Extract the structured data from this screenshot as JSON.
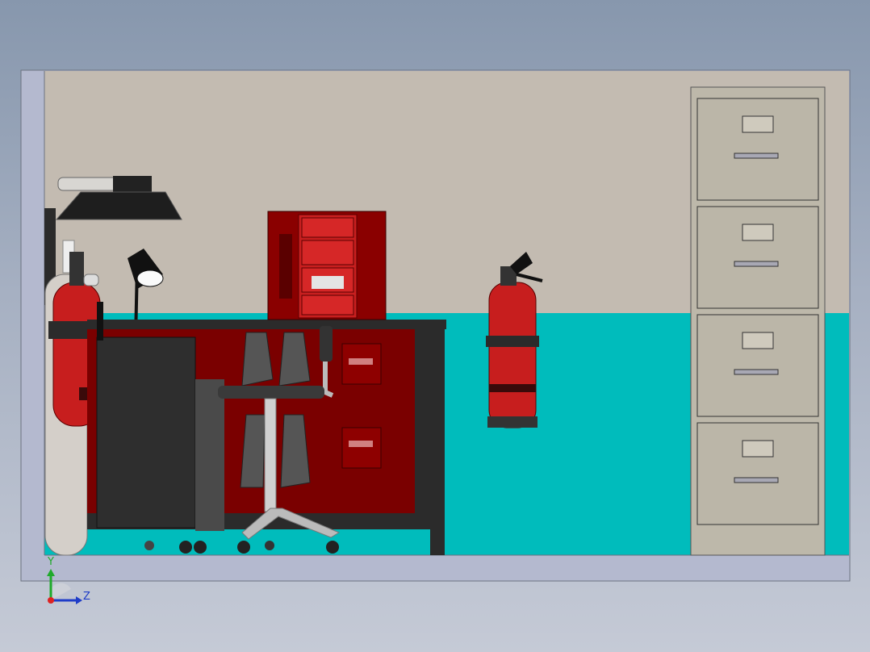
{
  "viewport": {
    "background_top": "#8797ad",
    "background_bottom": "#c5cad6"
  },
  "colors": {
    "room_frame": "#b4b9cf",
    "wall_upper": "#c3bbb1",
    "wall_lower": "#00bcbc",
    "cabinet_red": "#7a0000",
    "bright_red": "#cc1f1f",
    "dark_gray": "#2a2a2a",
    "file_cabinet": "#bdb8aa",
    "axis_x": "#1e3cc8",
    "axis_y": "#1faa2a"
  },
  "triad": {
    "y_label": "Y",
    "z_label": "Z",
    "icon": "coordinate-triad-icon"
  },
  "icons": {
    "fume_hood": "fume-hood-icon",
    "gas_cylinder": "gas-cylinder-icon",
    "desk_lamp": "desk-lamp-icon",
    "extinguisher": "fire-extinguisher-icon",
    "glovebox": "glovebox-icon",
    "tool_cabinet": "tool-cabinet-icon",
    "stool": "stool-icon",
    "file_cabinet": "file-cabinet-icon"
  }
}
